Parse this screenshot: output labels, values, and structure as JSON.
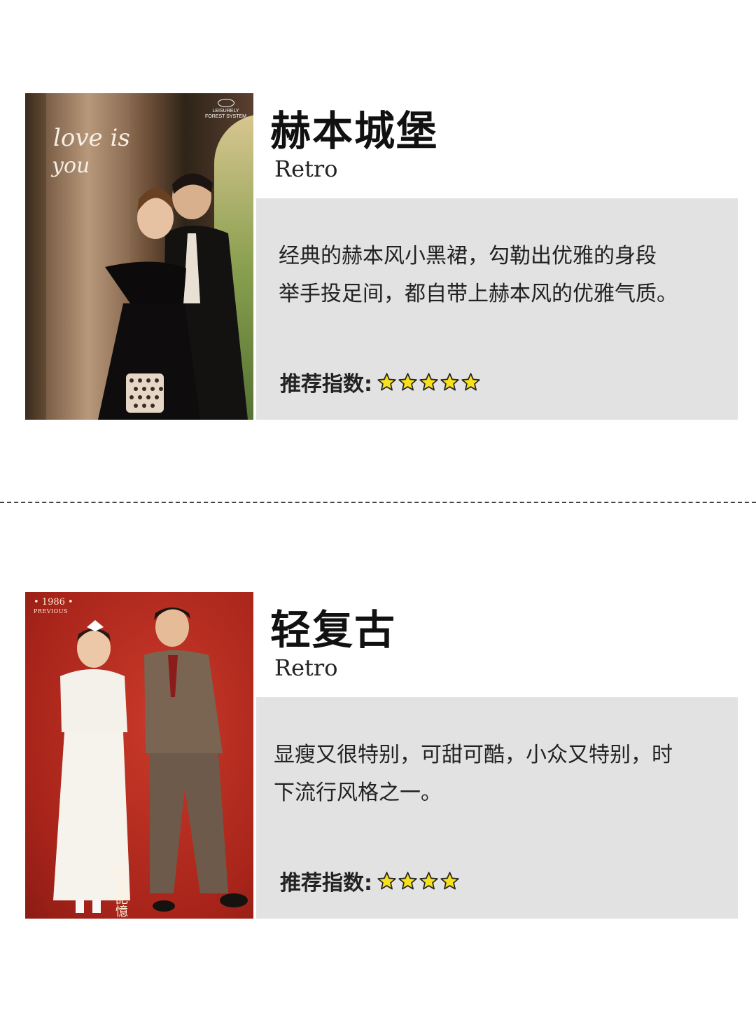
{
  "cards": [
    {
      "title": "赫本城堡",
      "subtitle": "Retro",
      "description": "经典的赫本风小黑裙，勾勒出优雅的身段\n举手投足间，都自带上赫本风的优雅气质。",
      "rating_label": "推荐指数:",
      "rating": 5,
      "photo": {
        "script_line1": "love is",
        "script_line2": "you",
        "logo_line1": "LEISURELY",
        "logo_line2": "FOREST SYSTEM"
      }
    },
    {
      "title": "轻复古",
      "subtitle": "Retro",
      "description": "显瘦又很特别，可甜可酷，小众又特别，时\n下流行风格之一。",
      "rating_label": "推荐指数:",
      "rating": 4,
      "photo": {
        "year": "• 1986 •",
        "year_sub": "PREVIOUS",
        "caption": "時代記憶"
      }
    }
  ],
  "colors": {
    "panel": "#e2e2e2",
    "star_fill": "#f7e01c",
    "star_stroke": "#222222"
  }
}
